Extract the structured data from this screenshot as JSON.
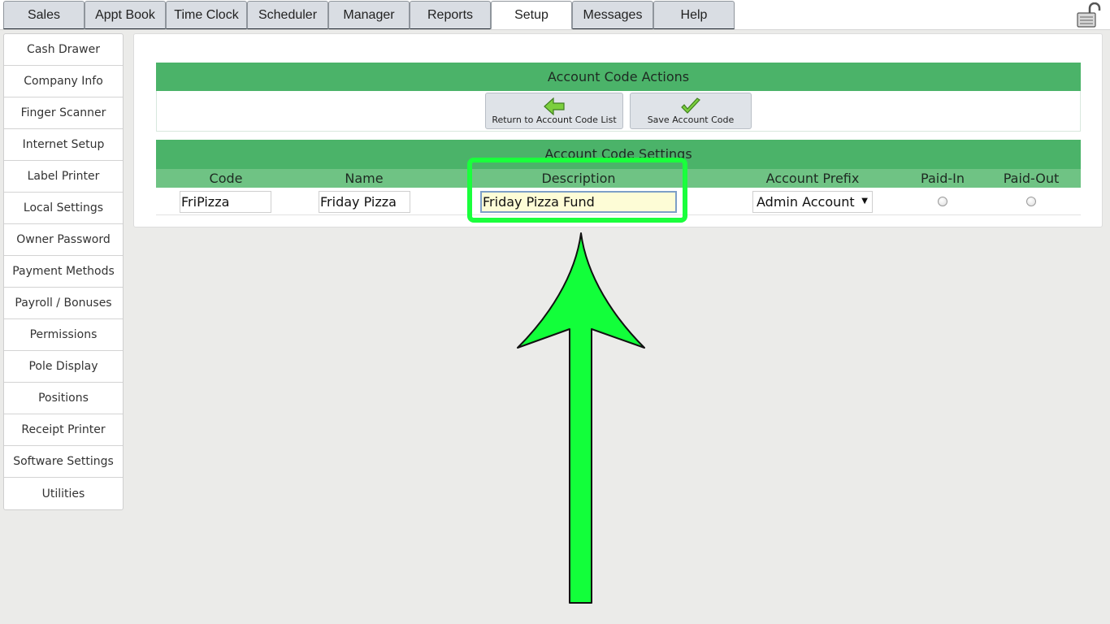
{
  "tabs": [
    {
      "label": "Sales"
    },
    {
      "label": "Appt Book"
    },
    {
      "label": "Time Clock"
    },
    {
      "label": "Scheduler"
    },
    {
      "label": "Manager"
    },
    {
      "label": "Reports"
    },
    {
      "label": "Setup"
    },
    {
      "label": "Messages"
    },
    {
      "label": "Help"
    }
  ],
  "active_tab": "Setup",
  "sidebar": {
    "items": [
      {
        "label": "Cash Drawer"
      },
      {
        "label": "Company Info"
      },
      {
        "label": "Finger Scanner"
      },
      {
        "label": "Internet Setup"
      },
      {
        "label": "Label Printer"
      },
      {
        "label": "Local Settings"
      },
      {
        "label": "Owner Password"
      },
      {
        "label": "Payment Methods"
      },
      {
        "label": "Payroll / Bonuses"
      },
      {
        "label": "Permissions"
      },
      {
        "label": "Pole Display"
      },
      {
        "label": "Positions"
      },
      {
        "label": "Receipt Printer"
      },
      {
        "label": "Software Settings"
      },
      {
        "label": "Utilities"
      }
    ]
  },
  "actions": {
    "title": "Account Code Actions",
    "return_label": "Return to Account Code List",
    "save_label": "Save Account Code"
  },
  "settings": {
    "title": "Account Code Settings",
    "columns": {
      "code": "Code",
      "name": "Name",
      "description": "Description",
      "account_prefix": "Account Prefix",
      "paid_in": "Paid-In",
      "paid_out": "Paid-Out"
    },
    "row": {
      "code": "FriPizza",
      "name": "Friday Pizza",
      "description": "Friday Pizza Fund",
      "account_prefix": "Admin Account",
      "paid_in_selected": false,
      "paid_out_selected": false
    }
  },
  "colors": {
    "header_green": "#4bb369",
    "subheader_green": "#6fc384",
    "annotation_green": "#1aff3c",
    "focused_input_bg": "#fdfcd6"
  },
  "icons": {
    "lock": "unlocked-lock-icon",
    "return": "arrow-left-icon",
    "save": "checkmark-icon"
  }
}
